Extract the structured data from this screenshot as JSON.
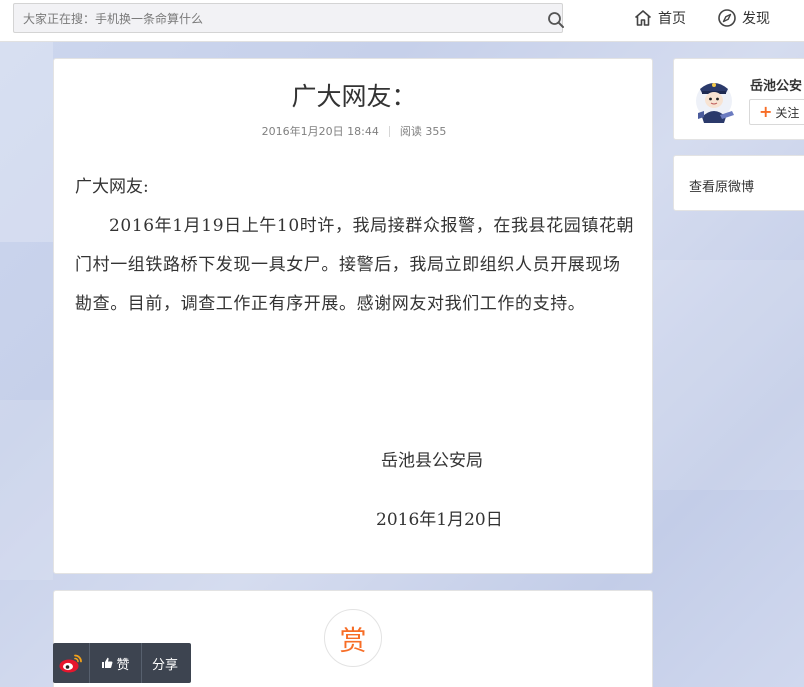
{
  "search": {
    "placeholder": "大家正在搜：手机换一条命算什么"
  },
  "nav": {
    "home_label": "首页",
    "discover_label": "发现"
  },
  "article": {
    "title": "广大网友：",
    "date": "2016年1月20日 18:44",
    "reads": "阅读 355",
    "salutation": "广大网友:",
    "paragraph": "2016年1月19日上午10时许，我局接群众报警，在我县花园镇花朝门村一组铁路桥下发现一具女尸。接警后，我局立即组织人员开展现场勘查。目前，调查工作正有序开展。感谢网友对我们工作的支持。",
    "signer": "岳池县公安局",
    "sign_date": "2016年1月20日"
  },
  "reward": {
    "label": "赏"
  },
  "sharebar": {
    "like_label": "赞",
    "share_label": "分享"
  },
  "sidebar": {
    "author_name": "岳池公安",
    "follow_label": "关注",
    "view_original": "查看原微博"
  },
  "colors": {
    "accent": "#f76d26",
    "sharebar_bg": "#3d4450",
    "text": "#333333"
  }
}
